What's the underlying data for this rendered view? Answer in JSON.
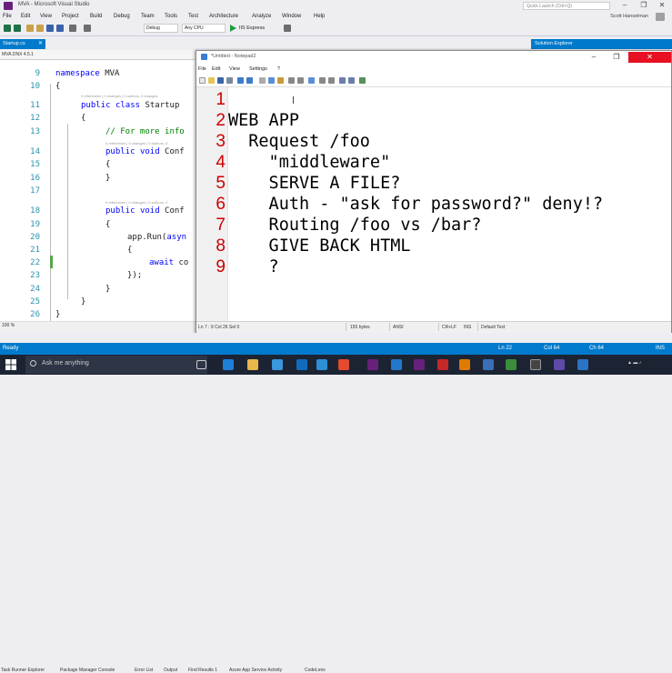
{
  "vs": {
    "title": "MVA - Microsoft Visual Studio",
    "quick_launch_placeholder": "Quick Launch (Ctrl+Q)",
    "user": "Scott Hanselman",
    "menu": [
      "File",
      "Edit",
      "View",
      "Project",
      "Build",
      "Debug",
      "Team",
      "Tools",
      "Test",
      "Architecture",
      "Analyze",
      "Window",
      "Help"
    ],
    "toolbar": {
      "config": "Debug",
      "platform": "Any CPU",
      "run_target": "IIS Express"
    },
    "tabs": {
      "active": "Startup.cs",
      "solution_explorer": "Solution Explorer"
    },
    "nav_bar": "MVA.DNX 4.5.1",
    "editor": {
      "zoom": "100 %",
      "line_numbers": [
        "9",
        "10",
        "11",
        "12",
        "13",
        "14",
        "15",
        "16",
        "17",
        "18",
        "19",
        "20",
        "21",
        "22",
        "23",
        "24",
        "25",
        "26"
      ],
      "hints": [
        "0 references | 0 changes | 0 authors, 0 changes",
        "0 references | 0 changes | 0 authors, 0",
        "0 references | 0 changes | 0 authors, 0"
      ],
      "code": {
        "l9_kw": "namespace",
        "l9_rest": " MVA",
        "l10": "{",
        "l11_kw1": "public",
        "l11_kw2": "class",
        "l11_rest": " Startup",
        "l12": "{",
        "l13": "// For more info",
        "l14_kw1": "public",
        "l14_kw2": "void",
        "l14_rest": " Conf",
        "l15": "{",
        "l16": "}",
        "l18_kw1": "public",
        "l18_kw2": "void",
        "l18_rest": " Conf",
        "l19": "{",
        "l20_a": "app.Run(",
        "l20_b": "asyn",
        "l21": "{",
        "l22_kw": "await",
        "l22_rest": " co",
        "l23": "});",
        "l24": "}",
        "l25": "}",
        "l26": "}"
      }
    },
    "tool_tabs": [
      "Task Runner Explorer",
      "Package Manager Console",
      "Error List",
      "Output",
      "Find Results 1",
      "Azure App Service Activity",
      "CodeLens"
    ],
    "status": {
      "state": "Ready",
      "ln": "Ln 22",
      "col": "Col 64",
      "ch": "Ch 64",
      "mode": "INS"
    }
  },
  "notepad": {
    "title": "*Untitled - Notepad2",
    "menu": [
      "File",
      "Edit",
      "View",
      "Settings",
      "?"
    ],
    "line_numbers": [
      "1",
      "2",
      "3",
      "4",
      "5",
      "6",
      "7",
      "8",
      "9"
    ],
    "lines": [
      "",
      "WEB APP",
      "  Request /foo",
      "    \"middleware\"",
      "    SERVE A FILE?",
      "    Auth - \"ask for password?\" deny!?",
      "    Routing /foo vs /bar?",
      "    GIVE BACK HTML",
      "    ?"
    ],
    "status": {
      "pos": "Ln 7 : 9   Col 26   Sel 0",
      "size": "155 bytes",
      "encoding": "ANSI",
      "eol": "CR+LF",
      "ins": "INS",
      "scheme": "Default Text"
    }
  },
  "taskbar": {
    "search_placeholder": "Ask me anything"
  },
  "colors": {
    "accent": "#007acc",
    "taskbar": "#1c2434",
    "line_number_red": "#cc0000"
  }
}
